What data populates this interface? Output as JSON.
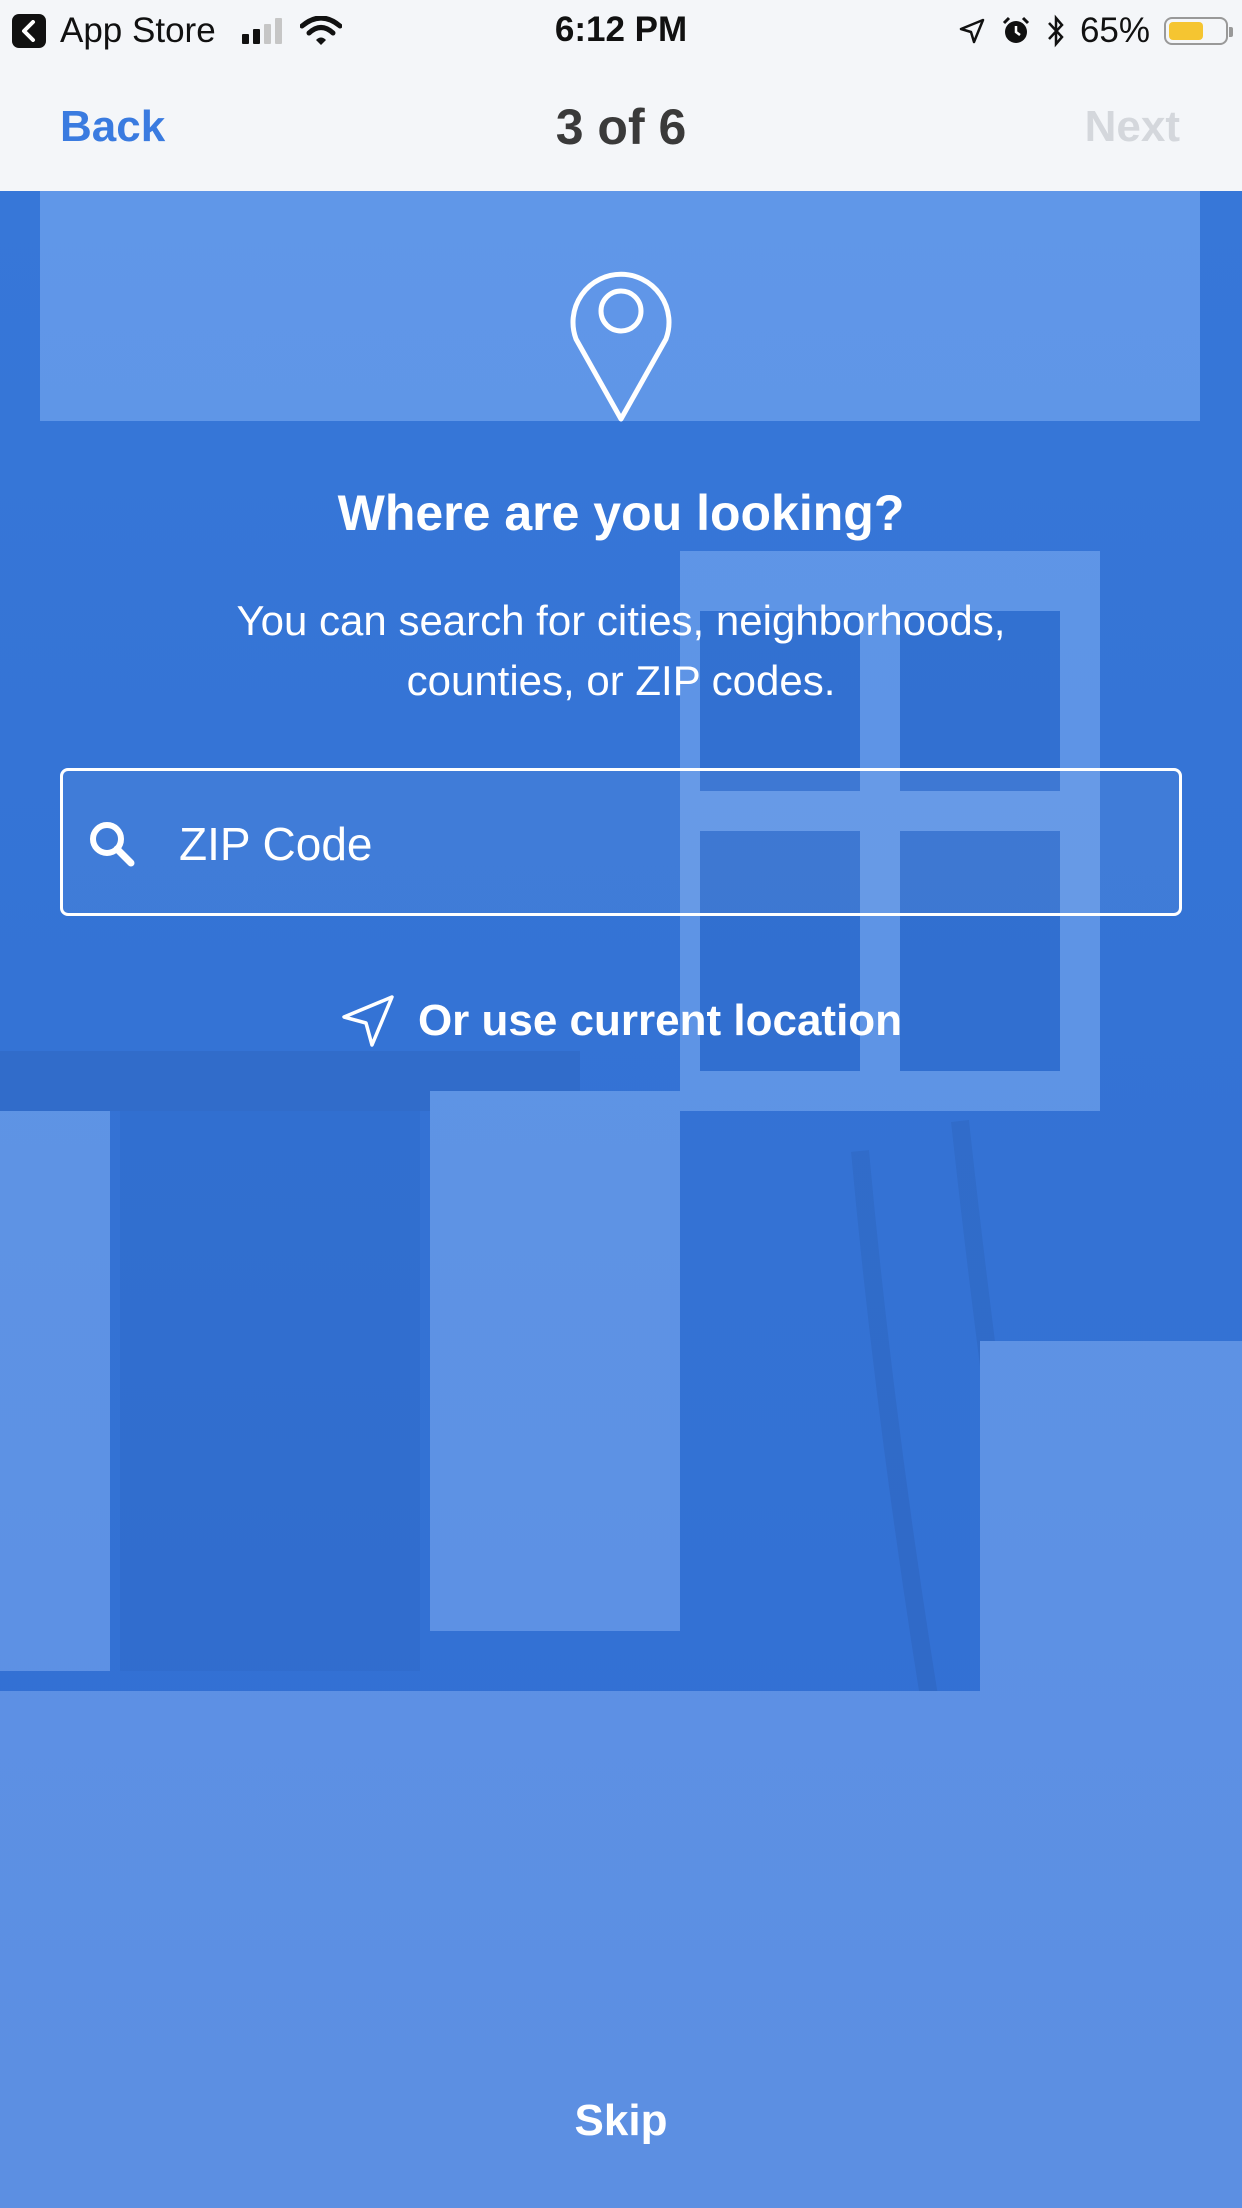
{
  "status_bar": {
    "back_app_label": "App Store",
    "time": "6:12 PM",
    "battery_percent": "65%",
    "battery_level": 0.65,
    "signal_bars_on": 2,
    "signal_bars_total": 4,
    "battery_color": "#f5c531"
  },
  "nav": {
    "back_label": "Back",
    "title": "3 of 6",
    "next_label": "Next"
  },
  "main": {
    "pin_icon": "map-pin-icon",
    "heading": "Where are you looking?",
    "subtext_line1": "You can search for cities, neighborhoods,",
    "subtext_line2": "counties, or ZIP codes.",
    "search": {
      "icon": "search-icon",
      "placeholder": "ZIP Code",
      "value": ""
    },
    "location": {
      "icon": "location-arrow-icon",
      "label": "Or use current location"
    },
    "skip_label": "Skip"
  },
  "colors": {
    "accent": "#3a7be0",
    "nav_background": "#f4f6f9",
    "next_disabled": "#d4d7dc"
  }
}
